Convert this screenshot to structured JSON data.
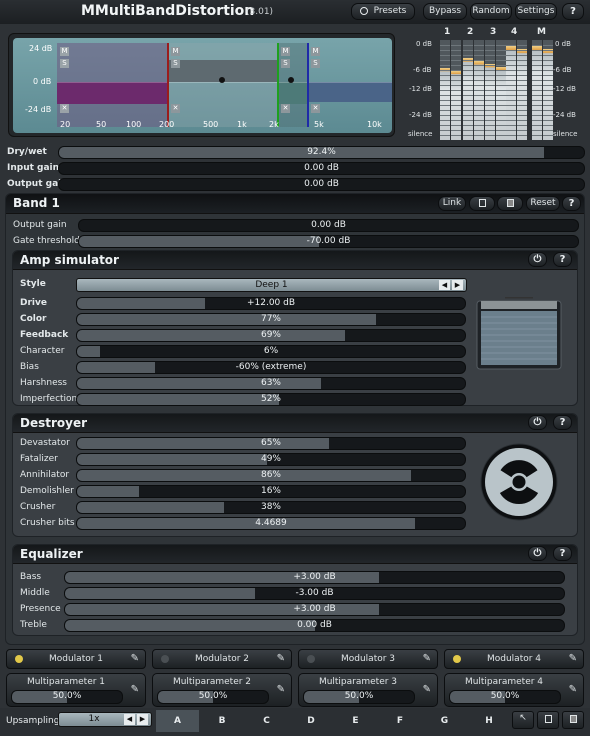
{
  "header": {
    "title": "MMultiBandDistortion",
    "version": "(3.01)",
    "presets": "Presets",
    "bypass": "Bypass",
    "random": "Random",
    "settings": "Settings",
    "help": "?"
  },
  "display": {
    "db_labels": [
      "24 dB",
      "0 dB",
      "-24 dB"
    ],
    "freq_labels": [
      "20",
      "50",
      "100",
      "200",
      "500",
      "1k",
      "2k",
      "5k",
      "10k"
    ],
    "band_marker_top": "M",
    "band_marker_mid": "S",
    "band_marker_x": "✕"
  },
  "meters": {
    "channels": [
      "1",
      "2",
      "3",
      "4",
      "M"
    ],
    "levels": [
      0.72,
      0.82,
      0.76,
      0.94,
      0.94
    ],
    "scale_left": [
      "0 dB",
      "-6 dB",
      "-12 dB",
      "-24 dB",
      "silence"
    ],
    "scale_right": [
      "0 dB",
      "-6 dB",
      "-12 dB",
      "-24 dB",
      "silence"
    ]
  },
  "global": {
    "rows": [
      {
        "label": "Dry/wet",
        "value": "92.4%",
        "fill": 0.924
      },
      {
        "label": "Input gain",
        "value": "0.00 dB",
        "fill": 0
      },
      {
        "label": "Output gain",
        "value": "0.00 dB",
        "fill": 0
      }
    ]
  },
  "band": {
    "title": "Band 1",
    "link": "Link",
    "reset": "Reset",
    "help": "?",
    "rows": [
      {
        "label": "Output gain",
        "value": "0.00 dB",
        "fill": 0
      },
      {
        "label": "Gate threshold",
        "value": "-70.00 dB",
        "fill": 0.48
      }
    ]
  },
  "amp": {
    "title": "Amp simulator",
    "help": "?",
    "style_label": "Style",
    "style_value": "Deep 1",
    "rows": [
      {
        "label": "Drive",
        "value": "+12.00 dB",
        "fill": 0.33,
        "bold": true
      },
      {
        "label": "Color",
        "value": "77%",
        "fill": 0.77,
        "bold": true
      },
      {
        "label": "Feedback",
        "value": "69%",
        "fill": 0.69,
        "bold": true
      },
      {
        "label": "Character",
        "value": "6%",
        "fill": 0.06
      },
      {
        "label": "Bias",
        "value": "-60% (extreme)",
        "fill": 0.2
      },
      {
        "label": "Harshness",
        "value": "63%",
        "fill": 0.63
      },
      {
        "label": "Imperfection",
        "value": "52%",
        "fill": 0.52
      }
    ]
  },
  "destroyer": {
    "title": "Destroyer",
    "help": "?",
    "rows": [
      {
        "label": "Devastator",
        "value": "65%",
        "fill": 0.65
      },
      {
        "label": "Fatalizer",
        "value": "49%",
        "fill": 0.49
      },
      {
        "label": "Annihilator",
        "value": "86%",
        "fill": 0.86
      },
      {
        "label": "Demolishler",
        "value": "16%",
        "fill": 0.16
      },
      {
        "label": "Crusher",
        "value": "38%",
        "fill": 0.38
      },
      {
        "label": "Crusher bits",
        "value": "4.4689",
        "fill": 0.87
      }
    ]
  },
  "equalizer": {
    "title": "Equalizer",
    "help": "?",
    "rows": [
      {
        "label": "Bass",
        "value": "+3.00 dB",
        "fill": 0.63
      },
      {
        "label": "Middle",
        "value": "-3.00 dB",
        "fill": 0.38
      },
      {
        "label": "Presence",
        "value": "+3.00 dB",
        "fill": 0.63
      },
      {
        "label": "Treble",
        "value": "0.00 dB",
        "fill": 0.5
      }
    ]
  },
  "modulators": [
    {
      "label": "Modulator 1",
      "active": true
    },
    {
      "label": "Modulator 2",
      "active": false
    },
    {
      "label": "Modulator 3",
      "active": false
    },
    {
      "label": "Modulator 4",
      "active": true
    }
  ],
  "multiparams": [
    {
      "label": "Multiparameter 1",
      "value": "50.0%"
    },
    {
      "label": "Multiparameter 2",
      "value": "50.0%"
    },
    {
      "label": "Multiparameter 3",
      "value": "50.0%"
    },
    {
      "label": "Multiparameter 4",
      "value": "50.0%"
    }
  ],
  "footer": {
    "upsampling_label": "Upsampling",
    "upsampling_value": "1x",
    "presets": [
      "A",
      "B",
      "C",
      "D",
      "E",
      "F",
      "G",
      "H"
    ],
    "active_preset": "A"
  },
  "colors": {
    "band1": "#6c2a6c",
    "band2": "#4e5e66",
    "band3": "#4b6a70",
    "band4": "#4a6488",
    "divider1": "#9b1c1c",
    "divider2": "#1ea01e",
    "divider3": "#1f2aa8",
    "led_on": "#e2c94a",
    "led_off": "#4a4f53"
  }
}
